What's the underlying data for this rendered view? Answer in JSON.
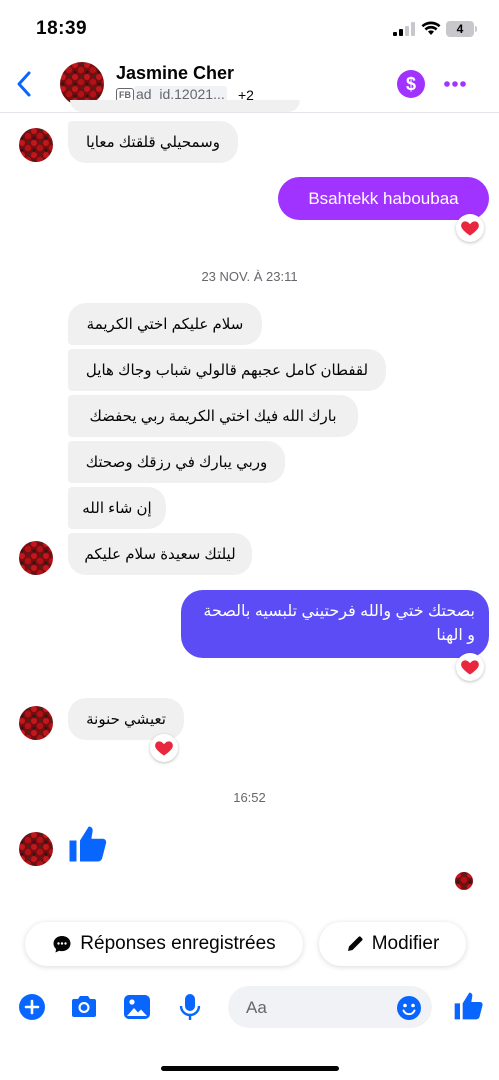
{
  "status_bar": {
    "time": "18:39",
    "battery": "4"
  },
  "header": {
    "contact_name": "Jasmine Cher",
    "source_tag": "FB",
    "ad_id": "ad_id.12021...",
    "participants_extra": "+2",
    "payment_icon": "dollar-icon",
    "more_icon": "more-dots-icon"
  },
  "messages": {
    "m1": "وسمحيلي قلقتك معايا",
    "m2": "Bsahtekk haboubaa",
    "ts1": "23 NOV. À 23:11",
    "m3": "سلام عليكم اختي الكريمة",
    "m4": "لقفطان كامل عجبهم قالولي شباب وجاك هايل",
    "m5": "بارك الله فيك اختي الكريمة ربي يحفضك",
    "m6": "وربي يبارك في رزقك وصحتك",
    "m7": "إن شاء الله",
    "m8": "ليلتك سعيدة سلام عليكم",
    "m9_line1": "بصحتك ختي والله فرحتيني تلبسيه بالصحة",
    "m9_line2": "و الهنا",
    "m10": "تعيشي حنونة",
    "ts2": "16:52",
    "reaction_icon": "heart-icon"
  },
  "quick_actions": {
    "saved_replies": "Réponses enregistrées",
    "edit": "Modifier"
  },
  "composer": {
    "placeholder": "Aa"
  },
  "colors": {
    "accent": "#0866ff",
    "bubble_purple": "#a033ff",
    "bubble_blue_purple": "#5b4cf5",
    "incoming": "#f0f0f0",
    "heart": "#e8263d"
  }
}
